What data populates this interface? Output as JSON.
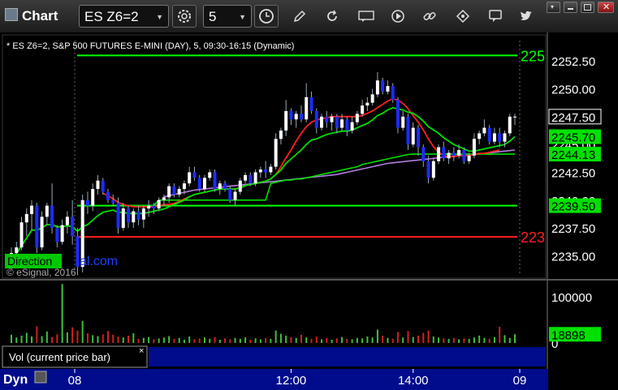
{
  "window": {
    "title": "Chart"
  },
  "toolbar": {
    "symbol": "ES Z6=2",
    "interval": "5"
  },
  "colors": {
    "background": "#000000",
    "up_candle": "#ffffff",
    "down_candle": "#1e2bff",
    "green_level": "#00ff00",
    "red_level": "#ff2020",
    "green_ma": "#00e000",
    "red_ma": "#ff2020",
    "purple_ma": "#b07de0",
    "panel_blue": "#000c8c"
  },
  "chart_data": [
    {
      "type": "candlestick",
      "title": "* ES Z6=2, S&P 500 FUTURES E-MINI (DAY), 5, 09:30-16:15 (Dynamic)",
      "y_ticks": [
        "2252.50",
        "2250.00",
        "2247.50",
        "2245.00",
        "2242.50",
        "2240.00",
        "2237.50",
        "2235.00"
      ],
      "ylim": [
        2233.5,
        2253.9
      ],
      "x_ticks": [
        "08",
        "12:00",
        "14:00",
        "09"
      ],
      "labels": {
        "direction": "Direction",
        "watermark_suffix": "al.com",
        "copyright": "© eSignal, 2016",
        "level_top_right": "225",
        "level_red_right": "223"
      },
      "price_labels": {
        "last": "2247.50",
        "ma_green_fast": "2245.70",
        "ma_green_step": "2244.13",
        "ma_green_level": "2239.50"
      },
      "levels": {
        "green_top": 2253.0,
        "green_low": 2239.5,
        "red": 2236.7
      },
      "candles": [
        [
          2234.5,
          2235.75,
          2233.75,
          2235.25
        ],
        [
          2235.25,
          2236.25,
          2234.75,
          2235.75
        ],
        [
          2235.75,
          2238.5,
          2235.5,
          2238.0
        ],
        [
          2238.0,
          2239.25,
          2236.75,
          2238.75
        ],
        [
          2238.75,
          2240.0,
          2237.25,
          2239.5
        ],
        [
          2239.5,
          2239.75,
          2235.25,
          2235.75
        ],
        [
          2235.75,
          2239.0,
          2235.5,
          2238.5
        ],
        [
          2238.5,
          2239.75,
          2237.75,
          2239.5
        ],
        [
          2239.5,
          2241.5,
          2237.0,
          2237.5
        ],
        [
          2237.5,
          2237.75,
          2235.75,
          2236.25
        ],
        [
          2236.25,
          2238.25,
          2236.0,
          2237.75
        ],
        [
          2237.75,
          2239.0,
          2237.0,
          2238.5
        ],
        [
          2238.5,
          2240.0,
          2236.0,
          2236.75
        ],
        [
          2236.75,
          2237.5,
          2233.25,
          2234.0
        ],
        [
          2234.0,
          2240.5,
          2233.5,
          2240.0
        ],
        [
          2240.0,
          2240.75,
          2238.75,
          2239.5
        ],
        [
          2239.5,
          2241.5,
          2239.0,
          2241.0
        ],
        [
          2241.0,
          2242.25,
          2240.5,
          2241.75
        ],
        [
          2241.75,
          2242.0,
          2240.5,
          2240.75
        ],
        [
          2240.75,
          2241.0,
          2239.75,
          2240.0
        ],
        [
          2240.0,
          2240.5,
          2239.5,
          2239.75
        ],
        [
          2239.75,
          2240.25,
          2237.0,
          2237.5
        ],
        [
          2237.5,
          2239.75,
          2237.25,
          2239.25
        ],
        [
          2239.25,
          2239.5,
          2237.5,
          2238.0
        ],
        [
          2238.0,
          2239.25,
          2237.5,
          2239.0
        ],
        [
          2239.0,
          2239.5,
          2237.75,
          2238.25
        ],
        [
          2238.25,
          2239.5,
          2237.5,
          2239.25
        ],
        [
          2239.25,
          2240.0,
          2238.5,
          2239.5
        ],
        [
          2239.5,
          2239.75,
          2238.75,
          2239.25
        ],
        [
          2239.25,
          2240.25,
          2239.0,
          2240.0
        ],
        [
          2240.0,
          2240.5,
          2239.5,
          2240.25
        ],
        [
          2240.25,
          2241.5,
          2239.75,
          2241.25
        ],
        [
          2241.25,
          2241.5,
          2240.25,
          2240.5
        ],
        [
          2240.5,
          2241.25,
          2240.25,
          2241.0
        ],
        [
          2241.0,
          2241.75,
          2240.5,
          2241.5
        ],
        [
          2241.5,
          2243.0,
          2241.25,
          2242.5
        ],
        [
          2242.5,
          2243.0,
          2241.75,
          2242.0
        ],
        [
          2242.0,
          2242.25,
          2240.75,
          2241.0
        ],
        [
          2241.0,
          2242.25,
          2240.75,
          2242.0
        ],
        [
          2242.0,
          2242.75,
          2241.75,
          2242.5
        ],
        [
          2242.5,
          2242.75,
          2240.75,
          2241.0
        ],
        [
          2241.0,
          2241.75,
          2240.5,
          2241.5
        ],
        [
          2241.5,
          2241.75,
          2240.75,
          2241.0
        ],
        [
          2241.0,
          2241.25,
          2239.75,
          2240.0
        ],
        [
          2240.0,
          2241.0,
          2239.5,
          2240.75
        ],
        [
          2240.75,
          2242.0,
          2240.5,
          2241.75
        ],
        [
          2241.75,
          2242.5,
          2241.5,
          2242.25
        ],
        [
          2242.25,
          2242.5,
          2241.25,
          2241.5
        ],
        [
          2241.5,
          2242.75,
          2241.25,
          2242.5
        ],
        [
          2242.5,
          2243.0,
          2242.0,
          2242.75
        ],
        [
          2242.75,
          2243.5,
          2242.0,
          2242.5
        ],
        [
          2242.5,
          2243.25,
          2242.25,
          2243.0
        ],
        [
          2243.0,
          2246.0,
          2242.75,
          2245.5
        ],
        [
          2245.5,
          2246.5,
          2245.0,
          2246.25
        ],
        [
          2246.25,
          2249.0,
          2245.75,
          2248.0
        ],
        [
          2248.0,
          2248.25,
          2246.75,
          2247.25
        ],
        [
          2247.25,
          2248.0,
          2246.5,
          2247.75
        ],
        [
          2247.75,
          2248.5,
          2247.0,
          2247.25
        ],
        [
          2247.25,
          2250.5,
          2247.0,
          2249.25
        ],
        [
          2249.25,
          2249.75,
          2247.75,
          2248.0
        ],
        [
          2248.0,
          2248.25,
          2246.0,
          2246.5
        ],
        [
          2246.5,
          2247.75,
          2246.25,
          2247.5
        ],
        [
          2247.5,
          2248.0,
          2246.5,
          2247.0
        ],
        [
          2247.0,
          2247.75,
          2246.25,
          2247.5
        ],
        [
          2247.5,
          2247.75,
          2246.0,
          2246.5
        ],
        [
          2246.5,
          2247.75,
          2246.25,
          2247.25
        ],
        [
          2247.25,
          2247.5,
          2245.75,
          2246.25
        ],
        [
          2246.25,
          2247.5,
          2246.0,
          2247.0
        ],
        [
          2247.0,
          2248.0,
          2246.75,
          2247.75
        ],
        [
          2247.75,
          2249.0,
          2247.5,
          2248.5
        ],
        [
          2248.5,
          2249.25,
          2248.0,
          2248.75
        ],
        [
          2248.75,
          2250.0,
          2248.5,
          2249.5
        ],
        [
          2249.5,
          2251.5,
          2249.25,
          2250.75
        ],
        [
          2250.75,
          2251.0,
          2249.5,
          2249.75
        ],
        [
          2249.75,
          2250.75,
          2249.5,
          2250.25
        ],
        [
          2250.25,
          2250.5,
          2248.75,
          2249.0
        ],
        [
          2249.0,
          2249.25,
          2246.0,
          2246.5
        ],
        [
          2246.5,
          2248.0,
          2246.25,
          2247.5
        ],
        [
          2247.5,
          2247.75,
          2244.5,
          2245.0
        ],
        [
          2245.0,
          2247.0,
          2244.75,
          2246.5
        ],
        [
          2246.5,
          2246.75,
          2244.0,
          2244.75
        ],
        [
          2244.75,
          2245.0,
          2243.0,
          2243.5
        ],
        [
          2243.5,
          2244.0,
          2241.5,
          2242.0
        ],
        [
          2242.0,
          2243.75,
          2241.75,
          2243.5
        ],
        [
          2243.5,
          2245.0,
          2243.25,
          2244.75
        ],
        [
          2244.75,
          2245.25,
          2243.5,
          2243.75
        ],
        [
          2243.75,
          2244.5,
          2243.25,
          2244.25
        ],
        [
          2244.25,
          2244.75,
          2243.5,
          2244.0
        ],
        [
          2244.0,
          2245.0,
          2243.75,
          2244.5
        ],
        [
          2244.5,
          2244.75,
          2243.25,
          2243.5
        ],
        [
          2243.5,
          2244.25,
          2243.25,
          2244.0
        ],
        [
          2244.0,
          2246.0,
          2243.75,
          2245.5
        ],
        [
          2245.5,
          2246.25,
          2245.0,
          2246.0
        ],
        [
          2246.0,
          2247.25,
          2245.75,
          2246.5
        ],
        [
          2246.5,
          2246.75,
          2245.0,
          2245.25
        ],
        [
          2245.25,
          2246.5,
          2245.0,
          2246.0
        ],
        [
          2246.0,
          2246.5,
          2244.75,
          2245.25
        ],
        [
          2245.25,
          2246.25,
          2244.75,
          2246.0
        ],
        [
          2246.0,
          2247.75,
          2245.75,
          2247.5
        ],
        [
          2247.5,
          2247.75,
          2246.75,
          2247.5
        ]
      ],
      "ma_green": [
        2234.8,
        2235.2,
        2235.9,
        2236.6,
        2237.3,
        2237.3,
        2237.5,
        2237.8,
        2237.8,
        2237.6,
        2237.6,
        2237.7,
        2237.6,
        2237.2,
        2237.6,
        2237.8,
        2238.2,
        2238.6,
        2238.9,
        2239.0,
        2239.1,
        2238.9,
        2238.9,
        2238.8,
        2238.8,
        2238.8,
        2238.8,
        2238.9,
        2239.0,
        2239.1,
        2239.2,
        2239.4,
        2239.6,
        2239.8,
        2240.0,
        2240.3,
        2240.5,
        2240.6,
        2240.7,
        2240.8,
        2240.9,
        2241.0,
        2241.0,
        2241.0,
        2241.0,
        2241.1,
        2241.3,
        2241.4,
        2241.5,
        2241.6,
        2241.7,
        2241.9,
        2242.3,
        2242.7,
        2243.3,
        2243.7,
        2244.1,
        2244.5,
        2245.0,
        2245.4,
        2245.5,
        2245.7,
        2245.9,
        2246.0,
        2246.1,
        2246.2,
        2246.2,
        2246.3,
        2246.5,
        2246.7,
        2246.9,
        2247.2,
        2247.6,
        2247.8,
        2248.1,
        2248.3,
        2248.2,
        2248.1,
        2247.9,
        2247.8,
        2247.5,
        2247.1,
        2246.6,
        2246.3,
        2246.0,
        2245.6,
        2245.3,
        2245.0,
        2244.8,
        2244.6,
        2244.4,
        2244.4,
        2244.5,
        2244.6,
        2244.7,
        2244.8,
        2244.9,
        2245.0,
        2245.3,
        2245.7
      ],
      "ma_red": [
        null,
        null,
        null,
        null,
        null,
        null,
        null,
        null,
        null,
        null,
        null,
        null,
        null,
        null,
        null,
        null,
        null,
        null,
        2240.6,
        2240.4,
        2240.1,
        2239.8,
        2239.6,
        2239.5,
        2239.4,
        2239.4,
        2239.4,
        2239.4,
        2239.4,
        2239.5,
        2239.6,
        2239.6,
        2239.7,
        2239.9,
        2240.1,
        2240.3,
        2240.5,
        2240.6,
        2240.7,
        2240.8,
        2240.9,
        2241.0,
        2241.0,
        2241.0,
        2241.0,
        2241.1,
        2241.3,
        2241.4,
        2241.5,
        2241.6,
        2241.7,
        2241.9,
        2242.3,
        2243.0,
        2243.8,
        2244.5,
        2245.3,
        2246.0,
        2246.6,
        2247.0,
        2247.2,
        2247.3,
        2247.4,
        2247.5,
        2247.5,
        2247.5,
        2247.5,
        2247.5,
        2247.5,
        2247.6,
        2247.8,
        2248.0,
        2248.3,
        2248.6,
        2248.9,
        2249.1,
        2249.0,
        2248.7,
        2248.2,
        2247.6,
        2247.0,
        2246.3,
        2245.5,
        2244.8,
        2244.3,
        2244.0,
        2243.9,
        2243.9,
        2244.0,
        2244.0,
        2244.0,
        2244.1,
        2244.2,
        2244.2,
        2244.3,
        2244.4,
        2244.5,
        null,
        null,
        null
      ],
      "ma_green_step": [
        null,
        null,
        null,
        null,
        null,
        null,
        null,
        null,
        null,
        null,
        null,
        null,
        null,
        null,
        null,
        null,
        null,
        null,
        null,
        null,
        null,
        null,
        2239.5,
        2239.5,
        2239.5,
        2239.5,
        2239.5,
        2239.5,
        2239.5,
        2240.0,
        2240.0,
        2240.0,
        2240.0,
        2240.0,
        2240.0,
        2240.0,
        2240.0,
        2240.0,
        2240.0,
        2240.0,
        2240.0,
        2240.0,
        2240.0,
        2240.0,
        2240.0,
        2240.0,
        2240.0,
        2240.0,
        2240.0,
        2240.0,
        2240.0,
        2241.5,
        2241.6,
        2241.7,
        2241.8,
        2241.8,
        2241.9,
        2241.9,
        2242.0,
        2242.1,
        2242.2,
        2242.3,
        2242.4,
        2242.5,
        2242.6,
        2242.7,
        2242.8,
        2242.9,
        2243.0,
        2243.2,
        2243.3,
        2243.4,
        2243.5,
        2243.6,
        2243.7,
        2243.8,
        2243.9,
        2244.0,
        2244.1,
        2244.13,
        2244.13,
        2244.13,
        2244.13,
        2244.13,
        2244.13,
        2244.13,
        2244.13,
        2244.13,
        2244.13,
        2244.13,
        2244.13,
        2244.13,
        2244.13,
        2244.13,
        2244.13,
        2244.13,
        2244.13,
        2244.13,
        2244.13,
        2244.13
      ],
      "ma_purple": [
        null,
        null,
        null,
        null,
        null,
        null,
        null,
        null,
        null,
        null,
        null,
        null,
        null,
        null,
        null,
        null,
        null,
        null,
        null,
        null,
        null,
        null,
        null,
        null,
        null,
        null,
        null,
        null,
        null,
        null,
        2240.3,
        2240.4,
        2240.5,
        2240.6,
        2240.7,
        2240.8,
        2240.9,
        2240.95,
        2241.0,
        2241.05,
        2241.1,
        2241.15,
        2241.2,
        2241.25,
        2241.3,
        2241.35,
        2241.4,
        2241.45,
        2241.5,
        2241.55,
        2241.6,
        2241.65,
        2241.7,
        2241.75,
        2241.8,
        2241.85,
        2241.9,
        2241.95,
        2242.0,
        2242.05,
        2242.1,
        2242.15,
        2242.2,
        2242.25,
        2242.3,
        2242.4,
        2242.5,
        2242.6,
        2242.7,
        2242.8,
        2242.9,
        2243.0,
        2243.1,
        2243.2,
        2243.3,
        2243.35,
        2243.4,
        2243.45,
        2243.5,
        2243.55,
        2243.6,
        2243.65,
        2243.7,
        2243.75,
        2243.8,
        2243.85,
        2243.9,
        2243.95,
        2244.0,
        2244.0,
        2244.05,
        2244.1,
        2244.15,
        2244.2,
        2244.25,
        2244.3,
        2244.35,
        2244.4,
        2244.45,
        2244.5
      ]
    },
    {
      "type": "bar",
      "title": "Vol (current price bar)",
      "y_ticks": [
        "100000",
        "0"
      ],
      "ylim": [
        0,
        125000
      ],
      "last_volume": "18898",
      "volumes": [
        18000,
        12000,
        16000,
        22000,
        14000,
        36000,
        15000,
        25000,
        13000,
        19000,
        128000,
        23000,
        34000,
        27000,
        48000,
        21000,
        17000,
        15000,
        19000,
        26000,
        18000,
        14000,
        12000,
        16000,
        21000,
        9000,
        11000,
        13000,
        8000,
        10000,
        12000,
        15000,
        9000,
        11000,
        7000,
        14000,
        8000,
        10000,
        12000,
        9000,
        13000,
        7000,
        10000,
        8000,
        11000,
        9000,
        12000,
        7000,
        10000,
        8000,
        11000,
        9000,
        27000,
        20000,
        16000,
        13000,
        11000,
        18000,
        12000,
        9000,
        14000,
        8000,
        11000,
        7000,
        10000,
        13000,
        9000,
        8000,
        11000,
        10000,
        14000,
        12000,
        29000,
        16000,
        11000,
        9000,
        24000,
        12000,
        26000,
        13000,
        16000,
        22000,
        27000,
        14000,
        12000,
        10000,
        9000,
        11000,
        8000,
        10000,
        9000,
        12000,
        16000,
        11000,
        9000,
        13000,
        35000,
        17000,
        11000,
        18898
      ]
    }
  ],
  "volume_label": "Vol (current price bar)",
  "time_axis": {
    "ticks": [
      "08",
      "12:00",
      "14:00",
      "09"
    ]
  },
  "bottom": {
    "dyn_label": "Dyn"
  }
}
